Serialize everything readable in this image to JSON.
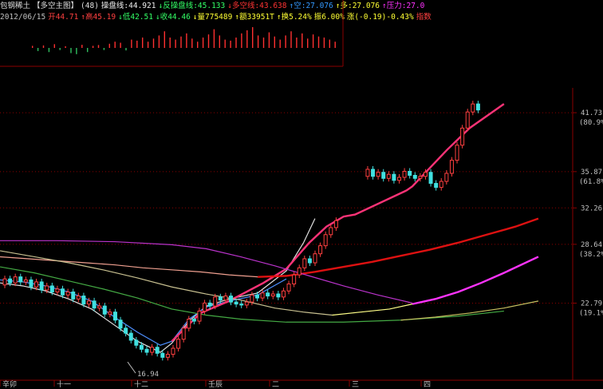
{
  "header": {
    "line1": [
      {
        "text": "包钢稀土",
        "color": "#e0e0e0"
      },
      {
        "text": "【多空主图】",
        "color": "#e0e0e0"
      },
      {
        "text": "(48)",
        "color": "#e0e0e0"
      },
      {
        "text": "操盘线:44.921",
        "color": "#f0f0f0"
      },
      {
        "text": "↓反操盘线:45.133",
        "color": "#33ff66"
      },
      {
        "text": "↓多空线:43.638",
        "color": "#ff3333"
      },
      {
        "text": "↑空:27.076",
        "color": "#3399ff"
      },
      {
        "text": "↑多:27.076",
        "color": "#ffff33"
      },
      {
        "text": "↑压力:27.0",
        "color": "#ff33ff"
      }
    ],
    "line2": [
      {
        "text": "2012/06/15",
        "color": "#c0c0c0"
      },
      {
        "text": "开44.71",
        "color": "#ff4040"
      },
      {
        "text": "↑高45.19",
        "color": "#ff4040"
      },
      {
        "text": "↓低42.51",
        "color": "#33ff66"
      },
      {
        "text": "↓收44.46",
        "color": "#33ff66"
      },
      {
        "text": "↓量775489",
        "color": "#ffff33"
      },
      {
        "text": "↑额33951T",
        "color": "#ffff33"
      },
      {
        "text": "↑换5.24%",
        "color": "#ffff33"
      },
      {
        "text": "振6.00%",
        "color": "#ffff33"
      },
      {
        "text": "涨(-0.19)-0.43%",
        "color": "#ffff33"
      },
      {
        "text": "指数",
        "color": "#ff4040"
      }
    ]
  },
  "chart_data": {
    "type": "candlestick",
    "symbol": "包钢稀土",
    "indicator": "多空主图",
    "yticks": [
      {
        "value": 41.73,
        "label": "41.73",
        "pct": "(80.9%)"
      },
      {
        "value": 35.87,
        "label": "35.87",
        "pct": "(61.8%)"
      },
      {
        "value": 32.26,
        "label": "32.26",
        "pct": ""
      },
      {
        "value": 28.64,
        "label": "28.64",
        "pct": "(38.2%)"
      },
      {
        "value": 22.79,
        "label": "22.79",
        "pct": "(19.1%)"
      }
    ],
    "xlabels": [
      "辛卯",
      "十一",
      "十二",
      "壬辰",
      "二",
      "三",
      "四"
    ],
    "low_annotation": "16.94",
    "low_value": 16.94,
    "candles": [
      {
        "o": 24.6,
        "c": 25.2
      },
      {
        "o": 25.2,
        "c": 24.8
      },
      {
        "o": 24.8,
        "c": 25.4
      },
      {
        "o": 25.4,
        "c": 24.9
      },
      {
        "o": 24.9,
        "c": 25.1
      },
      {
        "o": 25.1,
        "c": 24.4
      },
      {
        "o": 24.4,
        "c": 24.9
      },
      {
        "o": 24.9,
        "c": 24.1
      },
      {
        "o": 24.1,
        "c": 24.5
      },
      {
        "o": 24.5,
        "c": 23.9
      },
      {
        "o": 23.9,
        "c": 24.2
      },
      {
        "o": 24.2,
        "c": 23.6
      },
      {
        "o": 23.6,
        "c": 23.9
      },
      {
        "o": 23.9,
        "c": 23.2
      },
      {
        "o": 23.2,
        "c": 23.5
      },
      {
        "o": 23.5,
        "c": 22.7
      },
      {
        "o": 22.7,
        "c": 23.0
      },
      {
        "o": 23.0,
        "c": 22.3
      },
      {
        "o": 22.3,
        "c": 22.5
      },
      {
        "o": 22.5,
        "c": 21.7
      },
      {
        "o": 21.7,
        "c": 21.9
      },
      {
        "o": 21.9,
        "c": 21.1
      },
      {
        "o": 21.1,
        "c": 20.3
      },
      {
        "o": 20.3,
        "c": 19.8
      },
      {
        "o": 19.8,
        "c": 19.1
      },
      {
        "o": 19.1,
        "c": 18.6
      },
      {
        "o": 18.6,
        "c": 18.2
      },
      {
        "o": 18.2,
        "c": 17.9
      },
      {
        "o": 17.9,
        "c": 18.4
      },
      {
        "o": 18.4,
        "c": 17.8
      },
      {
        "o": 17.8,
        "c": 17.4
      },
      {
        "o": 17.4,
        "c": 17.7
      },
      {
        "o": 17.7,
        "c": 18.3
      },
      {
        "o": 18.3,
        "c": 19.2
      },
      {
        "o": 19.2,
        "c": 20.3
      },
      {
        "o": 20.3,
        "c": 21.2
      },
      {
        "o": 21.2,
        "c": 21.0
      },
      {
        "o": 21.0,
        "c": 22.0
      },
      {
        "o": 22.0,
        "c": 22.8
      },
      {
        "o": 22.8,
        "c": 22.5
      },
      {
        "o": 22.5,
        "c": 23.4
      },
      {
        "o": 23.4,
        "c": 23.1
      },
      {
        "o": 23.1,
        "c": 23.5
      },
      {
        "o": 23.5,
        "c": 22.9
      },
      {
        "o": 22.9,
        "c": 22.7
      },
      {
        "o": 22.7,
        "c": 22.6
      },
      {
        "o": 22.6,
        "c": 22.9
      },
      {
        "o": 22.9,
        "c": 23.6
      },
      {
        "o": 23.6,
        "c": 23.3
      },
      {
        "o": 23.3,
        "c": 23.8
      },
      {
        "o": 23.8,
        "c": 23.5
      },
      {
        "o": 23.5,
        "c": 23.7
      },
      {
        "o": 23.7,
        "c": 23.4
      },
      {
        "o": 23.4,
        "c": 24.0
      },
      {
        "o": 24.0,
        "c": 24.7
      },
      {
        "o": 24.7,
        "c": 25.6
      },
      {
        "o": 25.6,
        "c": 26.3
      },
      {
        "o": 26.3,
        "c": 27.2
      },
      {
        "o": 27.2,
        "c": 26.8
      },
      {
        "o": 26.8,
        "c": 27.7
      },
      {
        "o": 27.7,
        "c": 28.5
      },
      {
        "o": 28.5,
        "c": 29.6
      },
      {
        "o": 29.6,
        "c": 30.3
      },
      {
        "o": 30.3,
        "c": 31.0
      },
      {
        "gap": true
      },
      {
        "gap": true
      },
      {
        "gap": true
      },
      {
        "gap": true
      },
      {
        "gap": true
      },
      {
        "o": 35.4,
        "c": 36.1
      },
      {
        "o": 36.1,
        "c": 35.4
      },
      {
        "o": 35.4,
        "c": 35.8
      },
      {
        "o": 35.8,
        "c": 35.2
      },
      {
        "o": 35.2,
        "c": 35.6
      },
      {
        "o": 35.6,
        "c": 35.0
      },
      {
        "o": 35.0,
        "c": 35.3
      },
      {
        "o": 35.3,
        "c": 35.9
      },
      {
        "o": 35.9,
        "c": 35.5
      },
      {
        "o": 35.5,
        "c": 35.2
      },
      {
        "o": 35.2,
        "c": 35.4
      },
      {
        "o": 35.4,
        "c": 35.8
      },
      {
        "o": 35.8,
        "c": 34.7
      },
      {
        "o": 34.7,
        "c": 34.3
      },
      {
        "o": 34.3,
        "c": 34.9
      },
      {
        "o": 34.9,
        "c": 35.7
      },
      {
        "o": 35.7,
        "c": 37.0
      },
      {
        "o": 37.0,
        "c": 38.5
      },
      {
        "o": 38.5,
        "c": 40.2
      },
      {
        "o": 40.2,
        "c": 41.8
      },
      {
        "o": 41.8,
        "c": 42.6
      },
      {
        "o": 42.6,
        "c": 42.0
      }
    ],
    "volume_bars": [
      0.1,
      -0.15,
      0.12,
      -0.2,
      0.18,
      -0.1,
      0.08,
      -0.25,
      -0.3,
      0.15,
      -0.2,
      0.1,
      0.14,
      -0.1,
      0.2,
      0.3,
      0.25,
      -0.12,
      0.4,
      0.35,
      0.5,
      0.3,
      0.45,
      0.6,
      0.8,
      0.5,
      0.4,
      0.55,
      0.7,
      0.45,
      0.3,
      0.5,
      0.65,
      0.9,
      0.6,
      0.4,
      0.35,
      0.5,
      0.7,
      0.85,
      1.0,
      0.6,
      0.5,
      0.75,
      0.55,
      0.4,
      0.6,
      0.8,
      0.5,
      0.7,
      0.45,
      0.65,
      0.55,
      0.5,
      0.4,
      0.3
    ],
    "series": [
      {
        "id": "ma-white",
        "color": "#e0e0e0",
        "x": [
          0,
          0.04,
          0.08,
          0.12,
          0.16,
          0.2,
          0.24,
          0.28,
          0.3,
          0.33,
          0.36,
          0.4,
          0.45,
          0.5,
          0.53,
          0.55
        ],
        "y": [
          24.8,
          24.5,
          24.0,
          23.2,
          22.2,
          20.6,
          19.0,
          17.9,
          18.8,
          21.0,
          22.5,
          23.2,
          23.8,
          26.0,
          28.8,
          31.2
        ]
      },
      {
        "id": "ma-blue",
        "color": "#4d8fff",
        "x": [
          0,
          0.04,
          0.08,
          0.12,
          0.16,
          0.2,
          0.24,
          0.28,
          0.3,
          0.33,
          0.36,
          0.4,
          0.45,
          0.5
        ],
        "y": [
          25.1,
          24.9,
          24.5,
          23.9,
          23.0,
          21.4,
          19.9,
          18.6,
          19.0,
          21.2,
          22.4,
          23.0,
          23.6,
          25.2
        ]
      },
      {
        "id": "ma-pink",
        "color": "#ff3377",
        "x": [
          0.3,
          0.35,
          0.4,
          0.46,
          0.5,
          0.54,
          0.57,
          0.6,
          0.62,
          0.71,
          0.72,
          0.75,
          0.78,
          0.82,
          0.88
        ],
        "y": [
          19.0,
          21.8,
          23.0,
          24.8,
          26.2,
          28.8,
          30.4,
          31.4,
          31.6,
          34.0,
          34.4,
          36.2,
          38.0,
          40.2,
          42.6
        ]
      },
      {
        "id": "ma-darkred",
        "color": "#dd1111",
        "x": [
          0.45,
          0.5,
          0.55,
          0.6,
          0.65,
          0.7,
          0.75,
          0.8,
          0.85,
          0.9,
          0.94
        ],
        "y": [
          25.4,
          25.5,
          25.9,
          26.4,
          26.9,
          27.5,
          28.1,
          28.8,
          29.6,
          30.4,
          31.2
        ]
      },
      {
        "id": "ma-salmon",
        "color": "#f0a090",
        "x": [
          0,
          0.05,
          0.1,
          0.15,
          0.2,
          0.25,
          0.3,
          0.35,
          0.4,
          0.45
        ],
        "y": [
          27.4,
          27.2,
          27.0,
          26.8,
          26.6,
          26.3,
          26.1,
          25.9,
          25.6,
          25.4
        ]
      },
      {
        "id": "ma-purple",
        "color": "#bb33cc",
        "x": [
          0,
          0.1,
          0.2,
          0.3,
          0.36,
          0.42,
          0.48,
          0.54,
          0.6,
          0.66,
          0.72
        ],
        "y": [
          29.0,
          29.0,
          28.9,
          28.6,
          28.2,
          27.4,
          26.5,
          25.5,
          24.5,
          23.6,
          22.8
        ]
      },
      {
        "id": "ma-magenta",
        "color": "#ff33ff",
        "x": [
          0.72,
          0.76,
          0.8,
          0.84,
          0.88,
          0.94
        ],
        "y": [
          22.7,
          23.2,
          23.9,
          24.8,
          25.8,
          27.4
        ]
      },
      {
        "id": "ma-beige",
        "color": "#c8c090",
        "x": [
          0,
          0.06,
          0.12,
          0.18,
          0.24,
          0.3,
          0.36,
          0.42,
          0.48,
          0.53,
          0.58
        ],
        "y": [
          28.0,
          27.4,
          26.8,
          26.1,
          25.3,
          24.4,
          23.7,
          23.1,
          22.3,
          21.9,
          21.6
        ]
      },
      {
        "id": "ma-yellow",
        "color": "#ffff88",
        "x": [
          0.58,
          0.63,
          0.68,
          0.72
        ],
        "y": [
          21.6,
          21.9,
          22.2,
          22.7
        ]
      },
      {
        "id": "ma-green",
        "color": "#44aa44",
        "x": [
          0,
          0.06,
          0.12,
          0.18,
          0.24,
          0.3,
          0.36,
          0.42,
          0.5,
          0.6,
          0.7,
          0.8,
          0.88
        ],
        "y": [
          26.4,
          25.8,
          25.0,
          24.2,
          23.3,
          22.2,
          21.6,
          21.2,
          20.9,
          20.9,
          21.1,
          21.5,
          22.0
        ]
      },
      {
        "id": "ma-olive",
        "color": "#c8c060",
        "x": [
          0.7,
          0.76,
          0.82,
          0.88,
          0.94
        ],
        "y": [
          21.1,
          21.4,
          21.8,
          22.3,
          23.0
        ]
      }
    ],
    "ylim": [
      15.6,
      44.2
    ]
  }
}
